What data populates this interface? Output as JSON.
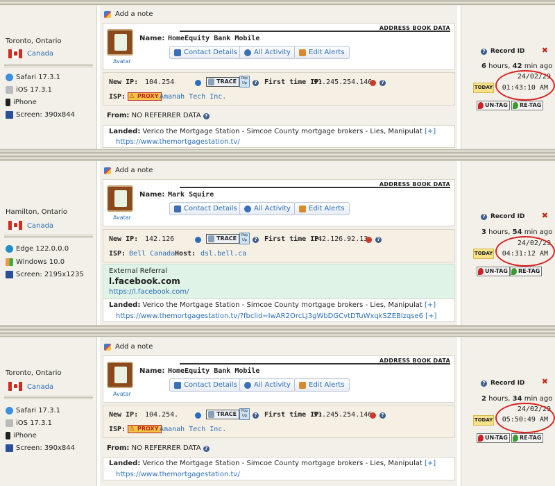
{
  "common": {
    "add_note": "Add a note",
    "address_book_data": "ADDRESS BOOK DATA",
    "avatar": "Avatar",
    "name_label": "Name:",
    "contact_details": "Contact Details",
    "all_activity": "All Activity",
    "edit_alerts": "Edit Alerts",
    "new_ip_label": "New IP:",
    "trace": "TRACE",
    "popup": "Pop Up",
    "first_time_ip_label": "First time IP:",
    "isp_label": "ISP:",
    "host_label": "Host:",
    "proxy": "PROXY",
    "from_label": "From:",
    "landed_label": "Landed:",
    "plus": "[+]",
    "record_id": "Record ID",
    "today": "TODAY",
    "untag": "UN-TAG",
    "retag": "RE-TAG",
    "close": "✖"
  },
  "records": [
    {
      "city": "Toronto, Ontario",
      "country": "Canada",
      "browser": "Safari 17.3.1",
      "os": "iOS 17.3.1",
      "device": "iPhone",
      "screen": "Screen: 390x844",
      "name": "HomeEquity Bank Mobile",
      "new_ip": "104.254",
      "first_ip": "91.245.254.146",
      "isp": "Amanah Tech Inc.",
      "from": "NO REFERRER DATA",
      "landed": "Verico the Mortgage Station - Simcoe County mortgage brokers - Lies, Manipulat",
      "landed_url": "https://www.themortgagestation.tv/",
      "ago_num1": "6",
      "ago_unit1": "hours,",
      "ago_num2": "42",
      "ago_unit2": "min ago",
      "date": "24/02/29",
      "time": "01:43:10 AM"
    },
    {
      "city": "Hamilton, Ontario",
      "country": "Canada",
      "browser": "Edge 122.0.0.0",
      "os": "Windows 10.0",
      "screen": "Screen: 2195x1235",
      "name": "Mark Squire",
      "new_ip": "142.126",
      "first_ip": "142.126.92.13",
      "isp": "Bell Canada",
      "host": "dsl.bell.ca",
      "ext_title": "External Referral",
      "ext_domain": "l.facebook.com",
      "ext_url": "https://l.facebook.com/",
      "landed": "Verico the Mortgage Station - Simcoe County mortgage brokers - Lies, Manipulat",
      "landed_url": "https://www.themortgagestation.tv/?fbclid=IwAR2OrcLJ3gWbDGCvtDTuWxqkSZEBlzqse6",
      "ago_num1": "3",
      "ago_unit1": "hours,",
      "ago_num2": "54",
      "ago_unit2": "min ago",
      "date": "24/02/29",
      "time": "04:31:12 AM"
    },
    {
      "city": "Toronto, Ontario",
      "country": "Canada",
      "browser": "Safari 17.3.1",
      "os": "iOS 17.3.1",
      "device": "iPhone",
      "screen": "Screen: 390x844",
      "name": "HomeEquity Bank Mobile",
      "new_ip": "104.254.",
      "first_ip": "91.245.254.146",
      "isp": "Amanah Tech Inc.",
      "from": "NO REFERRER DATA",
      "landed": "Verico the Mortgage Station - Simcoe County mortgage brokers - Lies, Manipulat",
      "landed_url": "https://www.themortgagestation.tv/",
      "ago_num1": "2",
      "ago_unit1": "hours,",
      "ago_num2": "34",
      "ago_unit2": "min ago",
      "date": "24/02/29",
      "time": "05:50:49 AM"
    }
  ]
}
